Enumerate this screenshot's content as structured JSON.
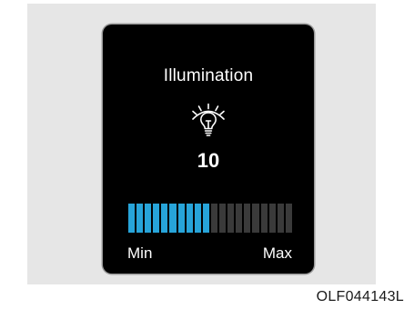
{
  "panel": {
    "title": "Illumination",
    "icon": "bulb-with-rays-icon",
    "value": "10",
    "level": {
      "current": 10,
      "total": 20,
      "min_label": "Min",
      "max_label": "Max"
    },
    "colors": {
      "active_segment": "#27a4d9",
      "inactive_segment": "#3a3a3a"
    }
  },
  "caption": "OLF044143L"
}
